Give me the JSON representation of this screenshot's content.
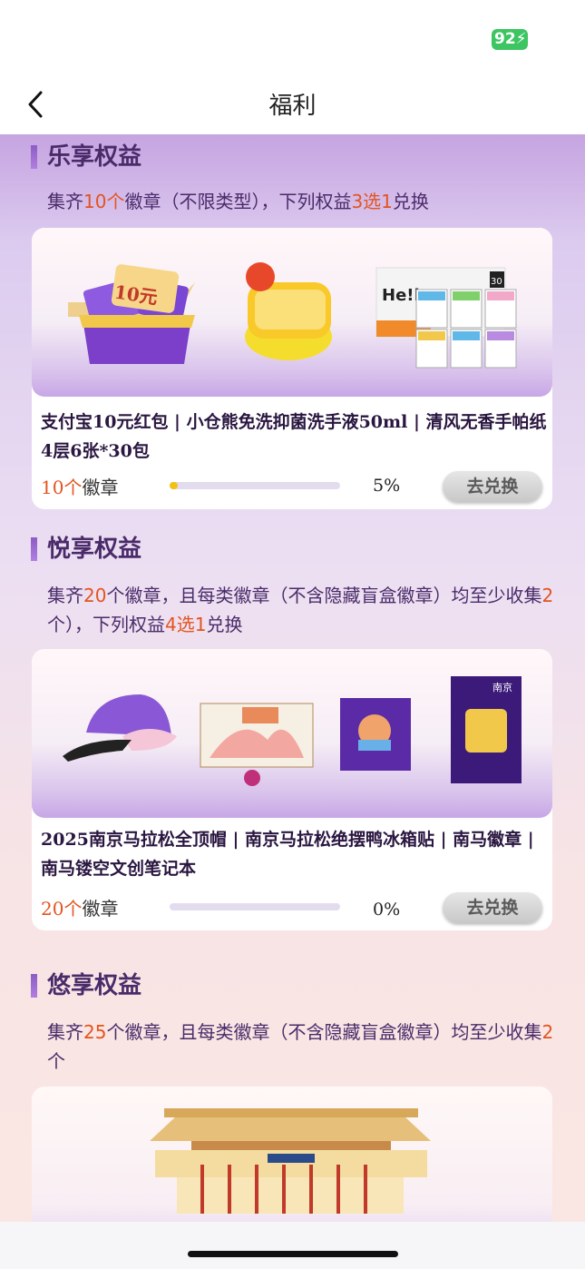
{
  "status_bar": {
    "battery": "92"
  },
  "nav": {
    "title": "福利"
  },
  "sections": [
    {
      "title": "乐享权益",
      "desc": [
        "集齐",
        "10个",
        "徽章（不限类型），下列权益",
        "3选1",
        "兑换"
      ],
      "card": {
        "items": "支付宝10元红包 | 小仓熊免洗抑菌洗手液50ml | 清风无香手帕纸 4层6张*30包",
        "badge_num": "10个",
        "badge_label": "徽章",
        "progress": 5,
        "progress_text": "5%",
        "button": "去兑换",
        "image_texts": {
          "voucher": "10元",
          "tissue_brand": "He!lo",
          "tissue_count": "30"
        }
      }
    },
    {
      "title": "悦享权益",
      "desc": [
        "集齐",
        "20",
        "个徽章，且每类徽章（不含隐藏盲盒徽章）均至少收集",
        "2",
        "个），下列权益",
        "4选1",
        "兑换"
      ],
      "card": {
        "items": "2025南京马拉松全顶帽 | 南京马拉松绝摆鸭冰箱贴 | 南马徽章 | 南马镂空文创笔记本",
        "badge_num": "20个",
        "badge_label": "徽章",
        "progress": 0,
        "progress_text": "0%",
        "button": "去兑换",
        "image_texts": {
          "notebook": "南京"
        }
      }
    },
    {
      "title": "悠享权益",
      "desc": [
        "集齐",
        "25",
        "个徽章，且每类徽章（不含隐藏盲盒徽章）均至少收集",
        "2",
        "个"
      ]
    }
  ],
  "colors": {
    "accent": "#e3541f",
    "title": "#4a2b6a",
    "battery": "#3dc562",
    "progress": "#f3c016"
  }
}
